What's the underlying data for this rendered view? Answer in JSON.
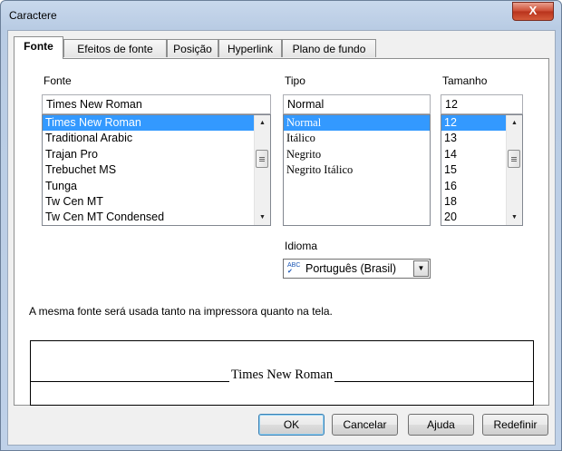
{
  "window": {
    "title": "Caractere",
    "close_label": "X"
  },
  "tabs": [
    {
      "label": "Fonte",
      "active": true
    },
    {
      "label": "Efeitos de fonte"
    },
    {
      "label": "Posição"
    },
    {
      "label": "Hyperlink"
    },
    {
      "label": "Plano de fundo"
    }
  ],
  "font": {
    "label": "Fonte",
    "value": "Times New Roman",
    "items": [
      "Times New Roman",
      "Traditional Arabic",
      "Trajan Pro",
      "Trebuchet MS",
      "Tunga",
      "Tw Cen MT",
      "Tw Cen MT Condensed"
    ],
    "selected_index": 0
  },
  "style": {
    "label": "Tipo",
    "value": "Normal",
    "items": [
      "Normal",
      "Itálico",
      "Negrito",
      "Negrito Itálico"
    ],
    "selected_index": 0
  },
  "size": {
    "label": "Tamanho",
    "value": "12",
    "items": [
      "12",
      "13",
      "14",
      "15",
      "16",
      "18",
      "20"
    ],
    "selected_index": 0
  },
  "language": {
    "label": "Idioma",
    "value": "Português (Brasil)",
    "icon": "spellcheck-icon",
    "icon_text": "ABC"
  },
  "info_text": "A mesma fonte será usada tanto na impressora quanto na tela.",
  "preview": {
    "text": "Times New Roman"
  },
  "buttons": {
    "ok": "OK",
    "cancel": "Cancelar",
    "help": "Ajuda",
    "reset": "Redefinir"
  }
}
